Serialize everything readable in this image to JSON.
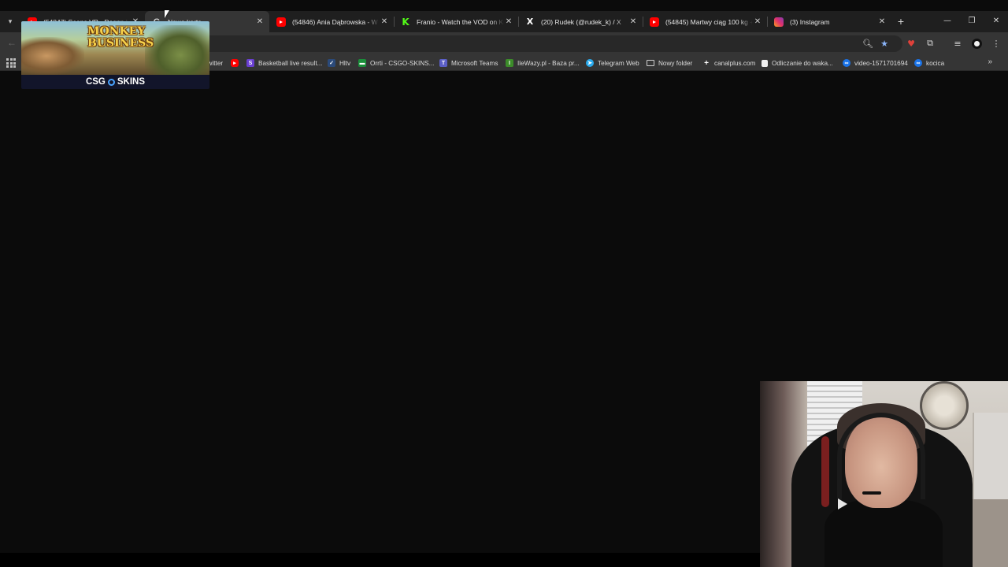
{
  "tabs": [
    {
      "title": "(54847) Seans VR - Dagon i...",
      "icon": "youtube-icon",
      "active": false
    },
    {
      "title": "Nowa karta",
      "icon": "google-icon",
      "active": true
    },
    {
      "title": "(54846) Ania Dąbrowska - W Głowie",
      "icon": "youtube-icon",
      "active": false
    },
    {
      "title": "Franio - Watch the VOD on Kick",
      "icon": "kick-icon",
      "active": false
    },
    {
      "title": "(20) Rudek (@rudek_k) / X",
      "icon": "x-icon",
      "active": false
    },
    {
      "title": "(54845) Martwy ciąg 100 kg + r",
      "icon": "youtube-icon",
      "active": false
    },
    {
      "title": "(3) Instagram",
      "icon": "instagram-icon",
      "active": false
    }
  ],
  "bookmarks": [
    {
      "label": "Twitter",
      "icon": "x-icon",
      "color": "#111111"
    },
    {
      "label": "",
      "icon": "youtube-icon",
      "color": "#ff0000"
    },
    {
      "label": "Basketball live result...",
      "icon": "flashscore-icon",
      "color": "#6a3fd1"
    },
    {
      "label": "Hltv",
      "icon": "hltv-icon",
      "color": "#2b4a7a"
    },
    {
      "label": "Orrti - CSGO-SKINS...",
      "icon": "csgoskins-icon",
      "color": "#1a8f3a"
    },
    {
      "label": "Microsoft Teams",
      "icon": "teams-icon",
      "color": "#5b5fc7"
    },
    {
      "label": "IleWazy.pl - Baza pr...",
      "icon": "ilewazy-icon",
      "color": "#3c8c2a"
    },
    {
      "label": "Telegram Web",
      "icon": "telegram-icon",
      "color": "#2aabee"
    },
    {
      "label": "Nowy folder",
      "icon": "folder-icon",
      "color": "#353535"
    },
    {
      "label": "canalplus.com",
      "icon": "canalplus-icon",
      "color": "#353535"
    },
    {
      "label": "Odliczanie do waka...",
      "icon": "calendar-icon",
      "color": "#f0f0f0"
    },
    {
      "label": "video-1571701694",
      "icon": "video-icon",
      "color": "#1a73e8"
    },
    {
      "label": "kocica",
      "icon": "video-icon",
      "color": "#1a73e8"
    }
  ],
  "ad": {
    "headline_line1": "MONKEY",
    "headline_line2": "BUSINESS",
    "brand_left": "CSG",
    "brand_right": "SKINS"
  }
}
